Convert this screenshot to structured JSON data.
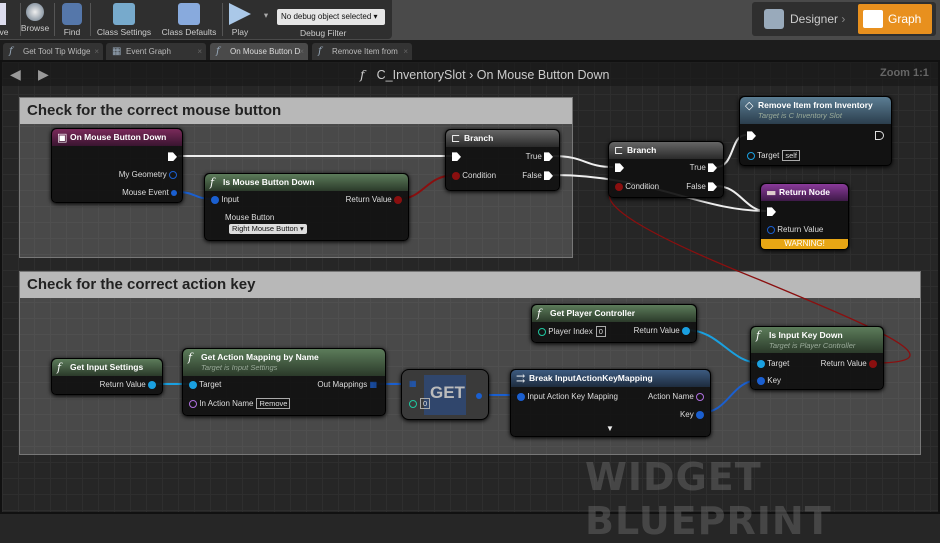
{
  "toolbar": {
    "save": "ve",
    "browse": "Browse",
    "find": "Find",
    "class_settings": "Class Settings",
    "class_defaults": "Class Defaults",
    "play": "Play",
    "debug_select": "No debug object selected",
    "debug_filter": "Debug Filter",
    "designer": "Designer",
    "graph": "Graph",
    "accent": "#e8901e"
  },
  "tabs": [
    {
      "label": "Get Tool Tip Widge",
      "icon": "function-icon"
    },
    {
      "label": "Event Graph",
      "icon": "graph-icon"
    },
    {
      "label": "On Mouse Button D",
      "icon": "function-icon",
      "active": true
    },
    {
      "label": "Remove Item from",
      "icon": "function-icon"
    }
  ],
  "header": {
    "class": "C_InventorySlot",
    "separator": "›",
    "function": "On Mouse Button Down",
    "zoom": "Zoom 1:1"
  },
  "comments": [
    "Check for the correct mouse button",
    "Check for the correct action key"
  ],
  "nodes": {
    "on_mouse_button_down": {
      "title": "On Mouse Button Down",
      "pins": [
        "My Geometry",
        "Mouse Event"
      ]
    },
    "is_mouse_button_down": {
      "title": "Is Mouse Button Down",
      "input": "Input",
      "return": "Return Value",
      "mouse_button": "Mouse Button",
      "mouse_button_value": "Right Mouse Button"
    },
    "branch1": {
      "title": "Branch",
      "true": "True",
      "condition": "Condition",
      "false": "False"
    },
    "branch2": {
      "title": "Branch",
      "true": "True",
      "condition": "Condition",
      "false": "False"
    },
    "remove_item": {
      "title": "Remove Item from Inventory",
      "subtitle": "Target is C Inventory Slot",
      "target": "Target",
      "target_value": "self"
    },
    "return_node": {
      "title": "Return Node",
      "return": "Return Value",
      "warning": "WARNING!"
    },
    "get_player_controller": {
      "title": "Get Player Controller",
      "player_index": "Player Index",
      "player_index_value": "0",
      "return": "Return Value"
    },
    "is_input_key_down": {
      "title": "Is Input Key Down",
      "subtitle": "Target is Player Controller",
      "target": "Target",
      "key": "Key",
      "return": "Return Value"
    },
    "get_input_settings": {
      "title": "Get Input Settings",
      "return": "Return Value"
    },
    "get_action_mapping": {
      "title": "Get Action Mapping by Name",
      "subtitle": "Target is Input Settings",
      "target": "Target",
      "in_action_name": "In Action Name",
      "in_action_name_value": "Remove",
      "out": "Out Mappings"
    },
    "get_array": {
      "title": "GET",
      "index": "0"
    },
    "break_mapping": {
      "title": "Break InputActionKeyMapping",
      "input": "Input Action Key Mapping",
      "action_name": "Action Name",
      "key": "Key"
    }
  },
  "watermark": "WIDGET BLUEPRINT"
}
